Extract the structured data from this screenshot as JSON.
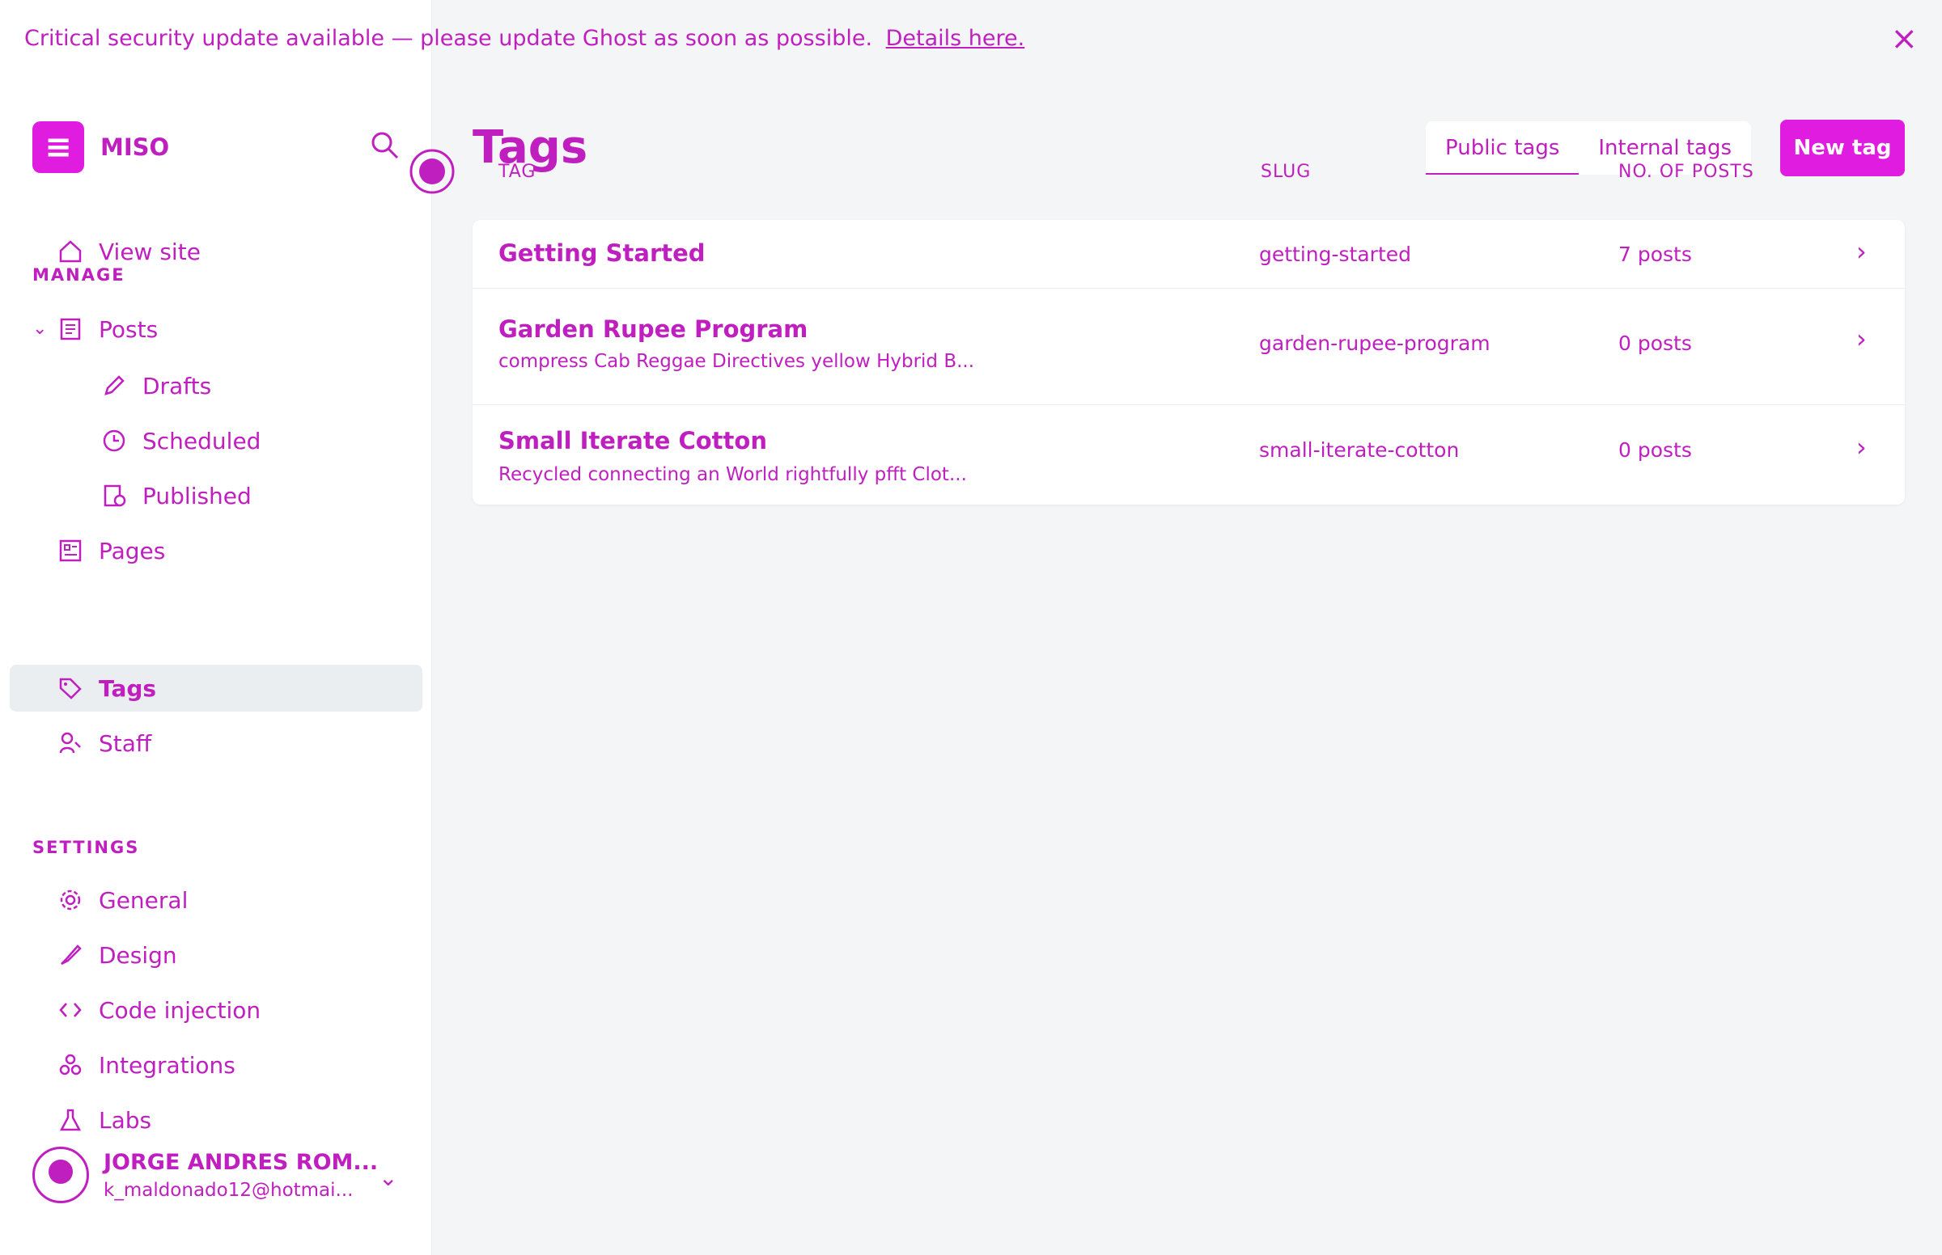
{
  "banner": {
    "message": "Critical security update available — please update Ghost as soon as possible.",
    "link": "Details here.",
    "close_icon": "close-icon"
  },
  "sidebar": {
    "site_name": "MISO",
    "logo_letter": "≡",
    "view_site": "View site",
    "manage_title": "MANAGE",
    "nav": [
      {
        "label": "Posts",
        "icon": "posts-icon"
      },
      {
        "label": "Drafts",
        "icon": "pencil-icon"
      },
      {
        "label": "Scheduled",
        "icon": "clock-icon"
      },
      {
        "label": "Published",
        "icon": "published-icon"
      },
      {
        "label": "Pages",
        "icon": "pages-icon"
      },
      {
        "label": "Tags",
        "icon": "tag-icon"
      },
      {
        "label": "Staff",
        "icon": "staff-icon"
      }
    ],
    "settings_title": "SETTINGS",
    "settings": [
      {
        "label": "General",
        "icon": "gear-icon"
      },
      {
        "label": "Design",
        "icon": "brush-icon"
      },
      {
        "label": "Code injection",
        "icon": "code-icon"
      },
      {
        "label": "Integrations",
        "icon": "integrations-icon"
      },
      {
        "label": "Labs",
        "icon": "flask-icon"
      }
    ],
    "user": {
      "name": "JORGE ANDRES ROM...",
      "email": "k_maldonado12@hotmai..."
    }
  },
  "main": {
    "title": "Tags",
    "tabs": [
      "Public tags",
      "Internal tags"
    ],
    "new_tag": "New tag",
    "columns": [
      "TAG",
      "SLUG",
      "NO. OF POSTS"
    ],
    "rows": [
      {
        "name": "Garden Rupee Program",
        "description": "compress Cab Reggae Directives yellow Hybrid B...",
        "slug": "garden-rupee-program",
        "count": "0 posts"
      },
      {
        "name": "Getting Started",
        "description": "",
        "slug": "getting-started",
        "count": "7 posts"
      },
      {
        "name": "Small Iterate Cotton",
        "description": "Recycled connecting an World rightfully pfft Clot...",
        "slug": "small-iterate-cotton",
        "count": "0 posts"
      }
    ]
  },
  "colors": {
    "accent": "#e01ce0",
    "text": "#c01fc0"
  }
}
